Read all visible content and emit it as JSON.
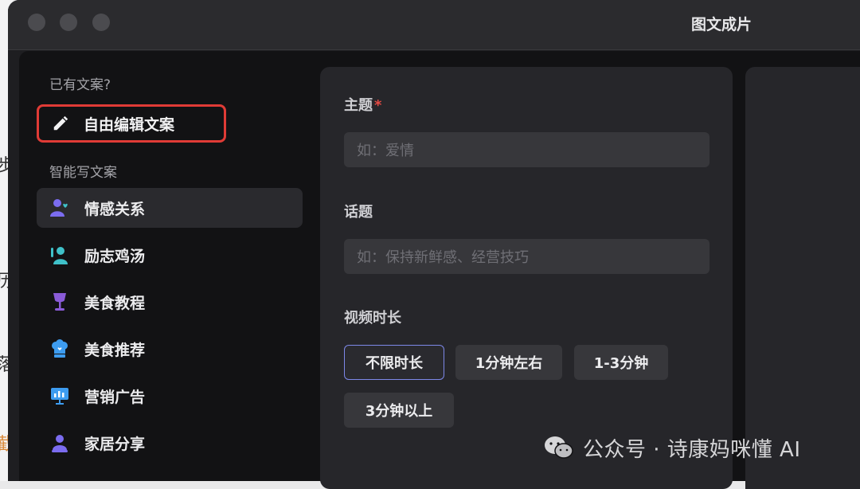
{
  "window": {
    "title": "图文成片"
  },
  "sidebar": {
    "has_copy_heading": "已有文案?",
    "free_edit_label": "自由编辑文案",
    "smart_heading": "智能写文案",
    "items": [
      {
        "label": "情感关系",
        "icon": "people-heart-icon",
        "active": true
      },
      {
        "label": "励志鸡汤",
        "icon": "person-raise-hand-icon",
        "active": false
      },
      {
        "label": "美食教程",
        "icon": "wine-glass-icon",
        "active": false
      },
      {
        "label": "美食推荐",
        "icon": "chef-hat-icon",
        "active": false
      },
      {
        "label": "营销广告",
        "icon": "presentation-board-icon",
        "active": false
      },
      {
        "label": "家居分享",
        "icon": "person-home-icon",
        "active": false
      }
    ]
  },
  "form": {
    "topic_label": "主题",
    "topic_required_mark": "*",
    "topic_placeholder": "如：爱情",
    "subject_label": "话题",
    "subject_placeholder": "如：保持新鲜感、经营技巧",
    "duration_label": "视频时长",
    "duration_options": [
      "不限时长",
      "1分钟左右",
      "1-3分钟",
      "3分钟以上"
    ],
    "duration_selected": "不限时长"
  },
  "watermark": {
    "text": "公众号 · 诗康妈咪懂 AI",
    "icon": "wechat-icon"
  },
  "colors": {
    "highlight_box": "#e03b36",
    "selected_chip_border": "#7d88e8",
    "required_mark": "#e54a44",
    "accent_purple": "#7b6cf0",
    "accent_teal": "#3fc1c9",
    "accent_blue": "#3d9cf0"
  }
}
